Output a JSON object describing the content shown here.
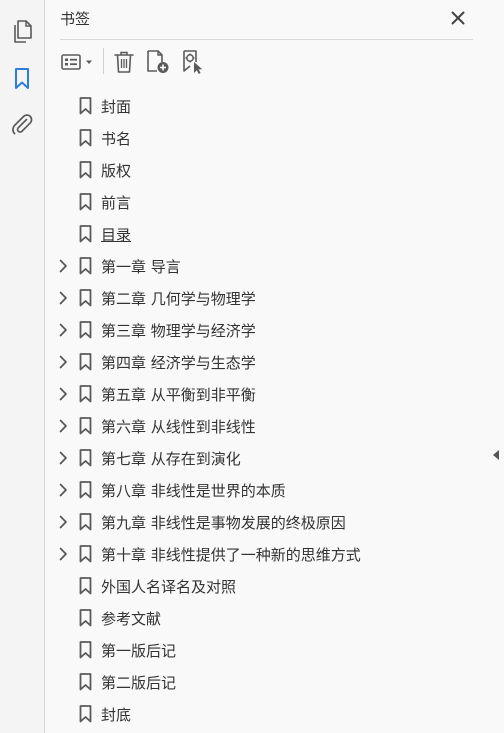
{
  "panel": {
    "title": "书签"
  },
  "rail": {
    "items": [
      {
        "icon": "page-thumbnails-icon",
        "active": false
      },
      {
        "icon": "bookmark-icon",
        "active": true
      },
      {
        "icon": "attachment-icon",
        "active": false
      }
    ]
  },
  "toolbar": {
    "buttons": [
      {
        "icon": "options-menu-icon"
      },
      {
        "icon": "delete-icon"
      },
      {
        "icon": "add-bookmark-icon"
      },
      {
        "icon": "new-bookmark-from-structure-icon"
      }
    ]
  },
  "bookmarks": [
    {
      "label": "封面",
      "expandable": false
    },
    {
      "label": "书名",
      "expandable": false
    },
    {
      "label": "版权",
      "expandable": false
    },
    {
      "label": "前言",
      "expandable": false
    },
    {
      "label": "目录",
      "expandable": false
    },
    {
      "label": "第一章  导言",
      "expandable": true
    },
    {
      "label": "第二章  几何学与物理学",
      "expandable": true
    },
    {
      "label": "第三章  物理学与经济学",
      "expandable": true
    },
    {
      "label": "第四章  经济学与生态学",
      "expandable": true
    },
    {
      "label": "第五章  从平衡到非平衡",
      "expandable": true
    },
    {
      "label": "第六章  从线性到非线性",
      "expandable": true
    },
    {
      "label": "第七章  从存在到演化",
      "expandable": true
    },
    {
      "label": "第八章  非线性是世界的本质",
      "expandable": true
    },
    {
      "label": "第九章  非线性是事物发展的终极原因",
      "expandable": true
    },
    {
      "label": "第十章  非线性提供了一种新的思维方式",
      "expandable": true
    },
    {
      "label": "外国人名译名及对照",
      "expandable": false
    },
    {
      "label": "参考文献",
      "expandable": false
    },
    {
      "label": "第一版后记",
      "expandable": false
    },
    {
      "label": "第二版后记",
      "expandable": false
    },
    {
      "label": "封底",
      "expandable": false
    }
  ],
  "colors": {
    "accent": "#2d7ed6",
    "icon": "#5a5a5a",
    "text": "#333333"
  }
}
